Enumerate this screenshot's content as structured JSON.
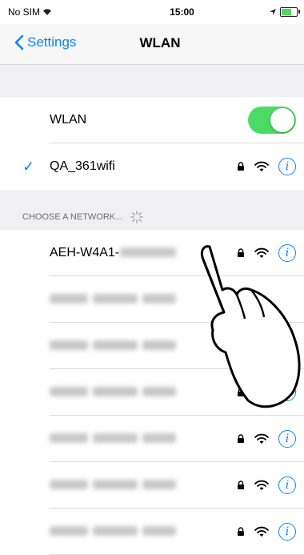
{
  "status": {
    "carrier": "No SIM",
    "time": "15:00",
    "battery_level": 0.75,
    "battery_color": "#4cd964"
  },
  "nav": {
    "back_label": "Settings",
    "title": "WLAN"
  },
  "wlan_toggle": {
    "label": "WLAN",
    "on": true
  },
  "connected_network": {
    "name": "QA_361wifi",
    "icons": [
      "lock-icon",
      "wifi-icon",
      "info-icon"
    ]
  },
  "section": {
    "header": "CHOOSE A NETWORK..."
  },
  "networks": [
    {
      "name": "AEH-W4A1-",
      "blurred_suffix": true
    },
    {
      "name": "",
      "blurred": true
    },
    {
      "name": "",
      "blurred": true
    },
    {
      "name": "",
      "blurred": true
    },
    {
      "name": "",
      "blurred": true
    },
    {
      "name": "",
      "blurred": true
    },
    {
      "name": "",
      "blurred": true
    }
  ],
  "colors": {
    "accent": "#0a84ff",
    "toggle_on": "#4cd964",
    "group_bg": "#efeff4"
  }
}
